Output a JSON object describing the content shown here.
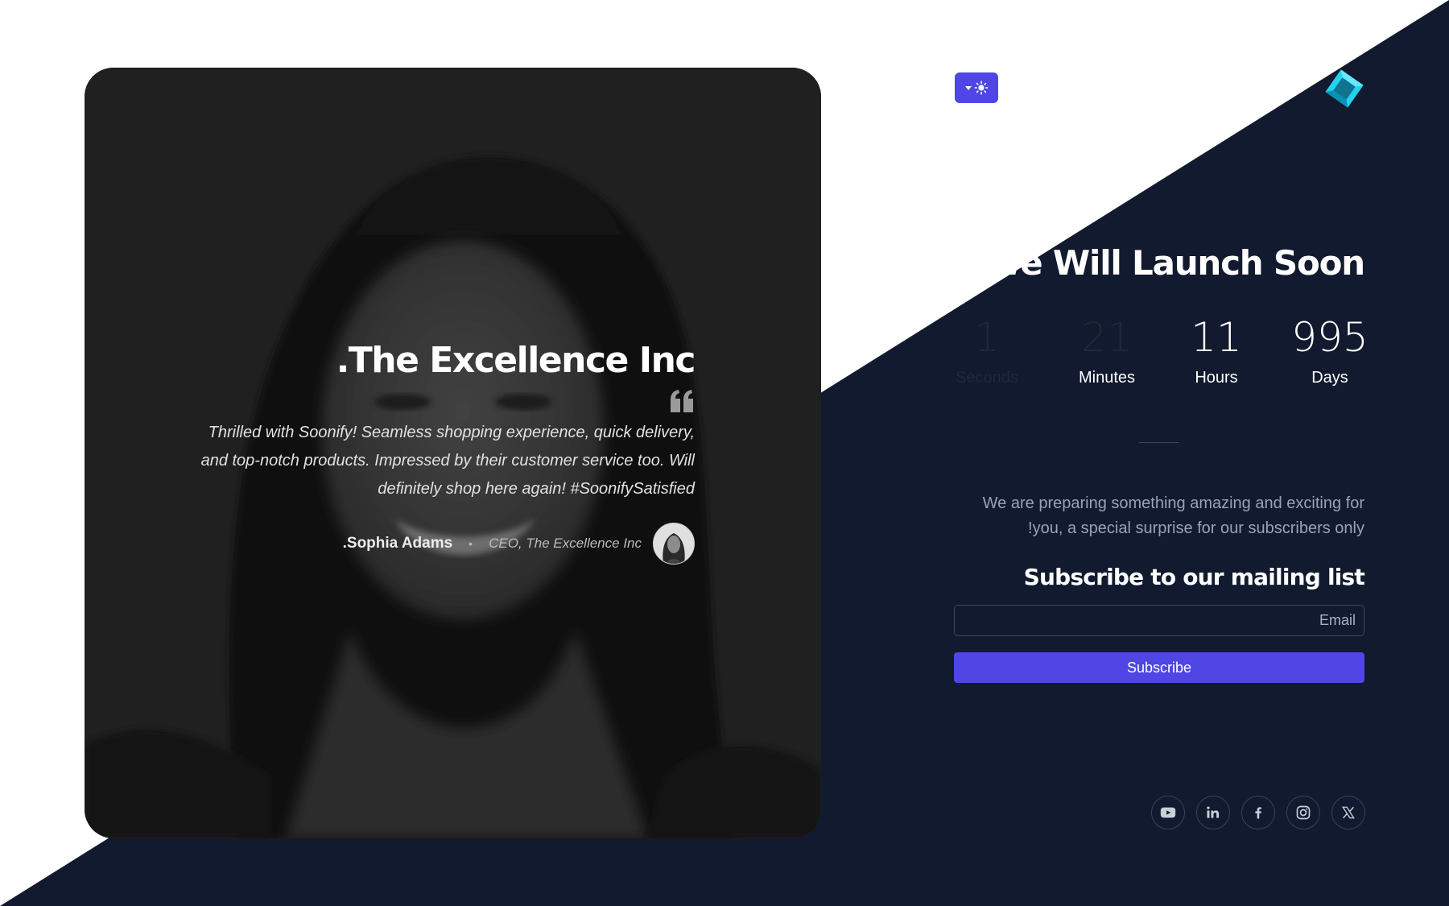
{
  "testimonial": {
    "company": ".The Excellence Inc",
    "quote": "Thrilled with Soonify! Seamless shopping experience, quick delivery, and top-notch products. Impressed by their customer service too. Will definitely shop here again! #SoonifySatisfied",
    "author_name": ".Sophia Adams",
    "author_separator": "•",
    "author_role": "CEO, The Excellence Inc"
  },
  "theme_toggle": {
    "icons": [
      "caret-down-icon",
      "sun-icon"
    ]
  },
  "logo": {
    "icon": "diamond-logo-icon",
    "color": "#22d3ee"
  },
  "launch": {
    "title": "We Will Launch Soon"
  },
  "countdown": [
    {
      "value": "1",
      "label": "Seconds"
    },
    {
      "value": "21",
      "label": "Minutes"
    },
    {
      "value": "11",
      "label": "Hours"
    },
    {
      "value": "995",
      "label": "Days"
    }
  ],
  "description": "We are preparing something amazing and exciting for !you, a special surprise for our subscribers only",
  "subscribe": {
    "heading": "Subscribe to our mailing list",
    "email_placeholder": "Email",
    "button_label": "Subscribe"
  },
  "social": [
    {
      "name": "youtube-icon"
    },
    {
      "name": "linkedin-icon"
    },
    {
      "name": "facebook-icon"
    },
    {
      "name": "instagram-icon"
    },
    {
      "name": "x-icon"
    }
  ],
  "colors": {
    "accent": "#4f46e5",
    "dark_bg": "#111a2e",
    "light_bg": "#ffffff"
  }
}
